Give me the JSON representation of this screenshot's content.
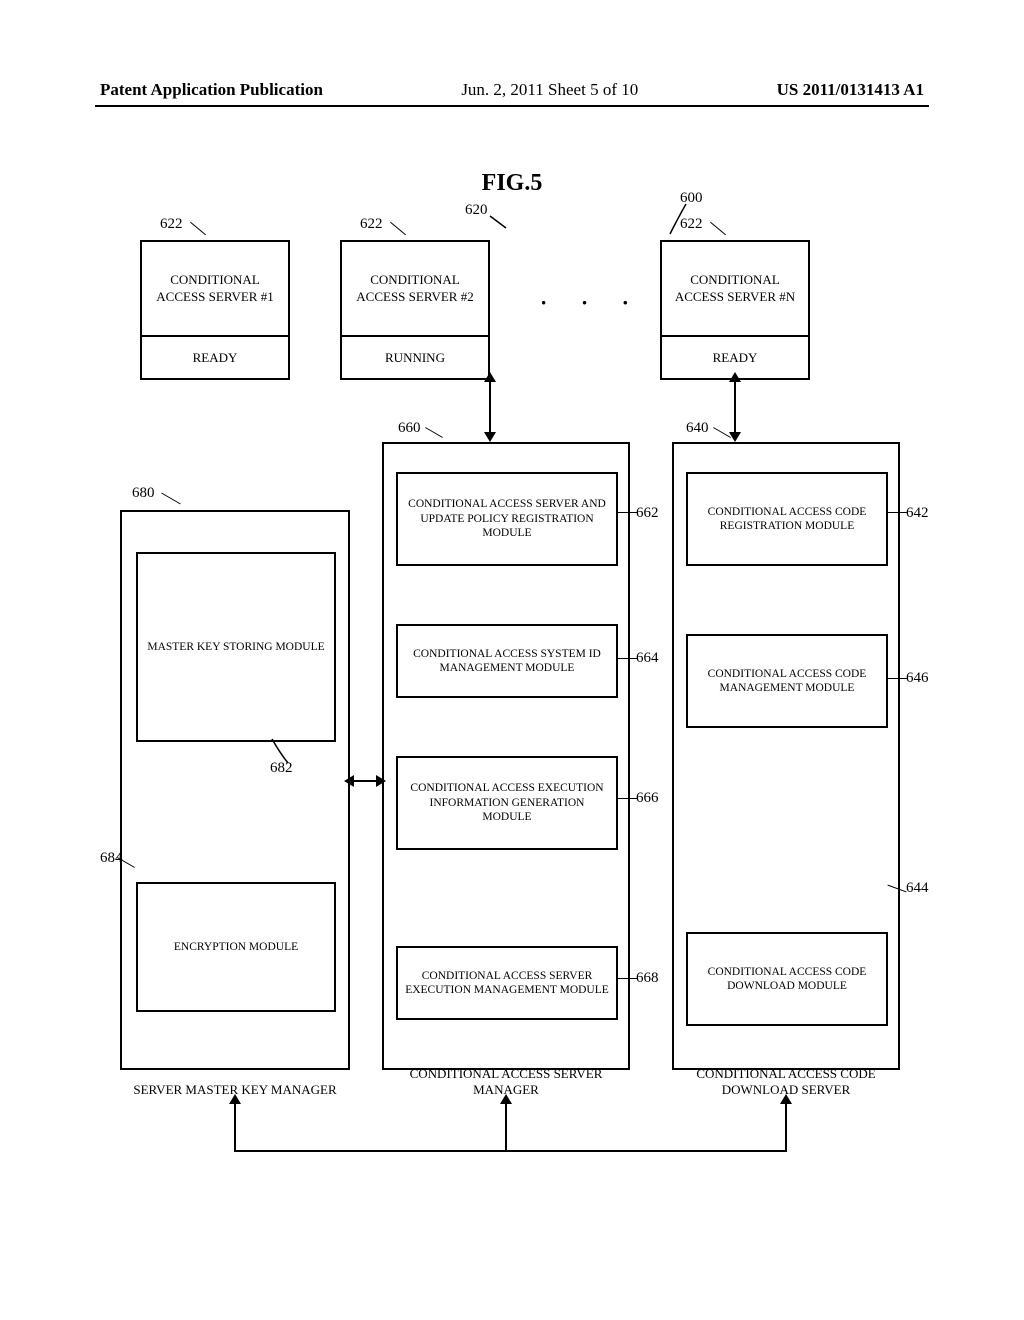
{
  "header": {
    "left": "Patent Application Publication",
    "center": "Jun. 2, 2011  Sheet 5 of 10",
    "right": "US 2011/0131413 A1"
  },
  "figure_label": "FIG.5",
  "refs": {
    "r600": "600",
    "r620": "620",
    "r622a": "622",
    "r622b": "622",
    "r622c": "622",
    "r640": "640",
    "r642": "642",
    "r644": "644",
    "r646": "646",
    "r660": "660",
    "r662": "662",
    "r664": "664",
    "r666": "666",
    "r668": "668",
    "r680": "680",
    "r682": "682",
    "r684": "684"
  },
  "servers": {
    "s1": {
      "title": "CONDITIONAL ACCESS SERVER #1",
      "status": "READY"
    },
    "s2": {
      "title": "CONDITIONAL ACCESS SERVER #2",
      "status": "RUNNING"
    },
    "sn": {
      "title": "CONDITIONAL ACCESS SERVER #N",
      "status": "READY"
    },
    "dots": "· · ·"
  },
  "col680": {
    "title": "SERVER MASTER KEY MANAGER",
    "m1": "MASTER KEY STORING MODULE",
    "m2": "ENCRYPTION MODULE"
  },
  "col660": {
    "title": "CONDITIONAL ACCESS SERVER MANAGER",
    "m1": "CONDITIONAL ACCESS SERVER AND UPDATE POLICY REGISTRATION MODULE",
    "m2": "CONDITIONAL ACCESS SYSTEM ID MANAGEMENT MODULE",
    "m3": "CONDITIONAL ACCESS EXECUTION INFORMATION GENERATION MODULE",
    "m4": "CONDITIONAL ACCESS SERVER EXECUTION MANAGEMENT MODULE"
  },
  "col640": {
    "title": "CONDITIONAL ACCESS CODE DOWNLOAD SERVER",
    "m1": "CONDITIONAL ACCESS CODE REGISTRATION MODULE",
    "m2": "CONDITIONAL ACCESS CODE MANAGEMENT MODULE",
    "m3": "CONDITIONAL ACCESS CODE DOWNLOAD MODULE"
  }
}
